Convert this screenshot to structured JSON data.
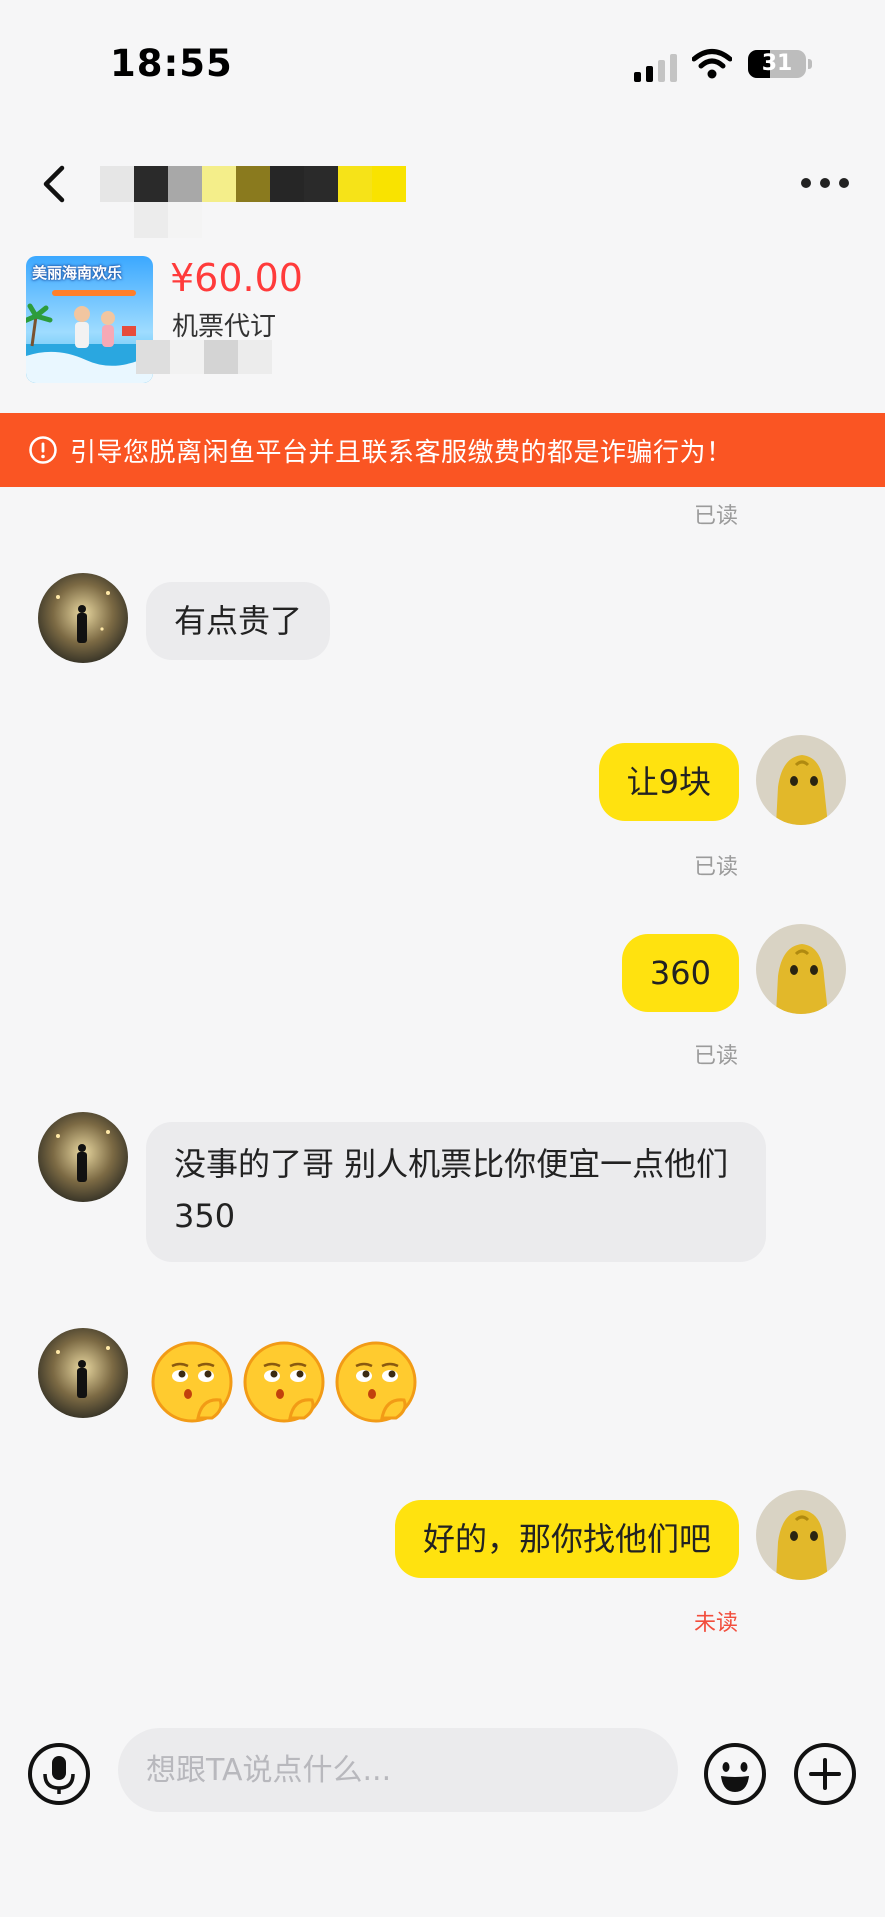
{
  "status_bar": {
    "time": "18:55",
    "battery": "31"
  },
  "header": {
    "seller_name_blur_colors": [
      "#e6e6e6",
      "#2a2a2a",
      "#a8a8a8",
      "#f4ee8a",
      "#8a7a1e",
      "#262626",
      "#2a2a2a",
      "#f6e318",
      "#f9e300"
    ]
  },
  "product": {
    "price": "¥60.00",
    "title": "机票代订",
    "thumb_text": "美丽海南欢乐"
  },
  "warning": {
    "text": "引导您脱离闲鱼平台并且联系客服缴费的都是诈骗行为！"
  },
  "messages": [
    {
      "side": "in",
      "text": "有点贵了"
    },
    {
      "side": "out",
      "text": "让9块",
      "status": "已读"
    },
    {
      "side": "out",
      "text": "360",
      "status": "已读"
    },
    {
      "side": "in",
      "text": "没事的了哥 别人机票比你便宜一点他们350"
    },
    {
      "side": "in",
      "emoji_count": 3
    },
    {
      "side": "out",
      "text": "好的，那你找他们吧",
      "status": "未读"
    }
  ],
  "top_read_status": "已读",
  "input": {
    "placeholder": "想跟TA说点什么..."
  },
  "colors": {
    "accent_yellow": "#ffe20f",
    "warning_orange": "#fa5523",
    "price_red": "#ff3b3b",
    "unread_red": "#f24d3c"
  }
}
